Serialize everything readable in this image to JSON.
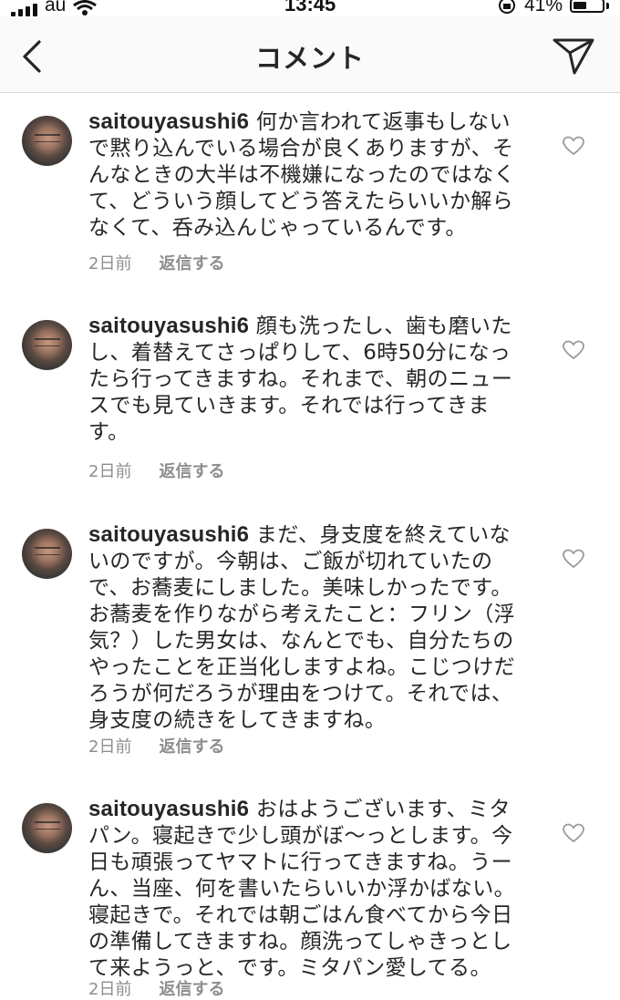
{
  "status_bar": {
    "carrier": "au",
    "time": "13:45",
    "battery": "41%"
  },
  "header": {
    "title": "コメント"
  },
  "comments": [
    {
      "username": "saitouyasushi6",
      "text": "何か言われて返事もしないで黙り込んでいる場合が良くありますが、そんなときの大半は不機嫌になったのではなくて、どういう顔してどう答えたらいいか解らなくて、呑み込んじゃっているんです。",
      "time": "2日前",
      "reply_label": "返信する"
    },
    {
      "username": "saitouyasushi6",
      "text": "顔も洗ったし、歯も磨いたし、着替えてさっぱりして、6時50分になったら行ってきますね。それまで、朝のニュースでも見ていきます。それでは行ってきます。",
      "time": "2日前",
      "reply_label": "返信する"
    },
    {
      "username": "saitouyasushi6",
      "text": "まだ、身支度を終えていないのですが。今朝は、ご飯が切れていたので、お蕎麦にしました。美味しかったです。お蕎麦を作りながら考えたこと：フリン（浮気？）した男女は、なんとでも、自分たちのやったことを正当化しますよね。こじつけだろうが何だろうが理由をつけて。それでは、身支度の続きをしてきますね。",
      "time": "2日前",
      "reply_label": "返信する"
    },
    {
      "username": "saitouyasushi6",
      "text": "おはようございます、ミタパン。寝起きで少し頭がぼ〜っとします。今日も頑張ってヤマトに行ってきますね。うーん、当座、何を書いたらいいか浮かばない。寝起きで。それでは朝ごはん食べてから今日の準備してきますね。顔洗ってしゃきっとして来ようっと、です。ミタパン愛してる。",
      "time": "2日前",
      "reply_label": "返信する"
    }
  ]
}
